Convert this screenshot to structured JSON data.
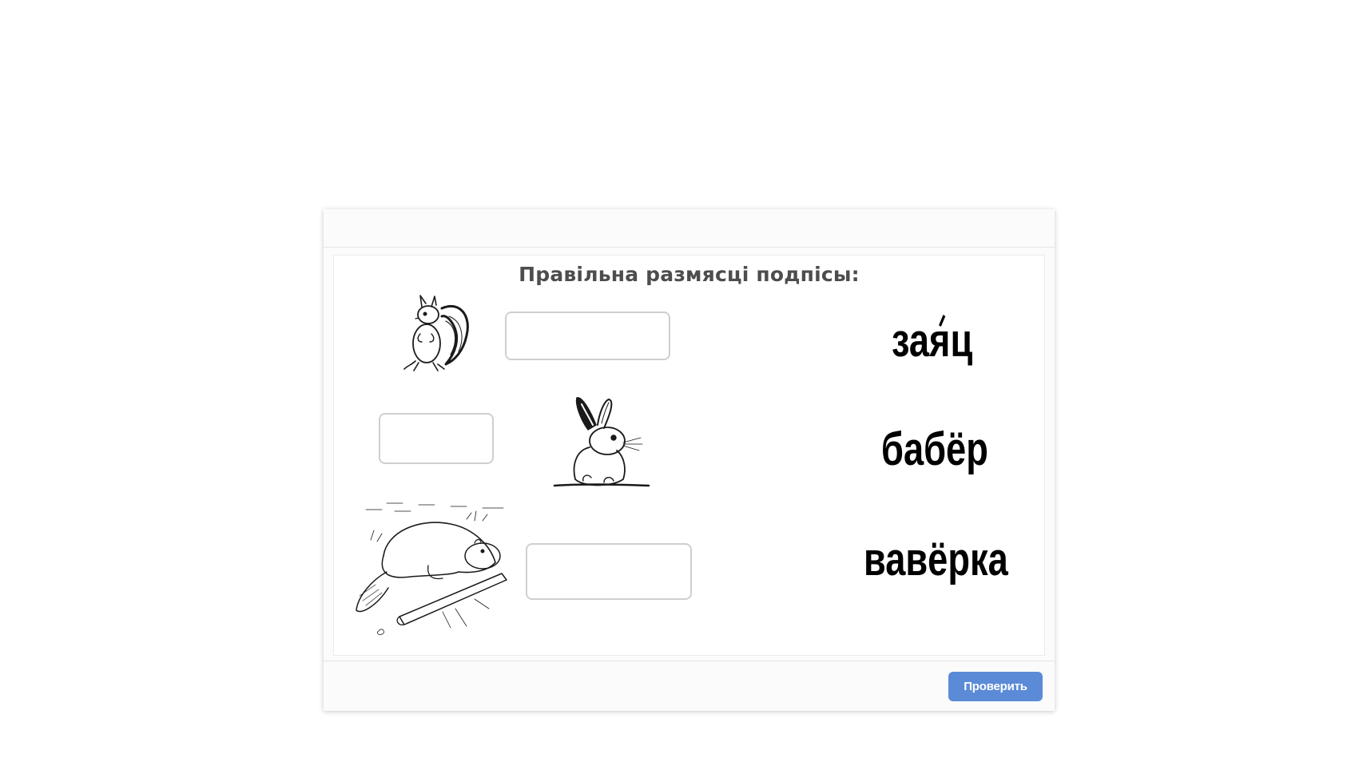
{
  "task": {
    "title": "Правільна размясці подпісы:"
  },
  "pictures": [
    {
      "name": "squirrel-image",
      "subject": "squirrel"
    },
    {
      "name": "rabbit-image",
      "subject": "rabbit"
    },
    {
      "name": "beaver-image",
      "subject": "beaver"
    }
  ],
  "drop_zones": [
    {
      "name": "drop-box-squirrel",
      "value": ""
    },
    {
      "name": "drop-box-rabbit",
      "value": ""
    },
    {
      "name": "drop-box-beaver",
      "value": ""
    }
  ],
  "words": {
    "word1_prefix": "за",
    "word1_stressed": "я",
    "word1_suffix": "ц",
    "word2": "бабёр",
    "word3": "вавёрка"
  },
  "footer": {
    "check_label": "Проверить"
  },
  "colors": {
    "check_button": "#5b8bd6",
    "title_text": "#4d4d4d",
    "drop_box_border": "#cfcfcf"
  }
}
